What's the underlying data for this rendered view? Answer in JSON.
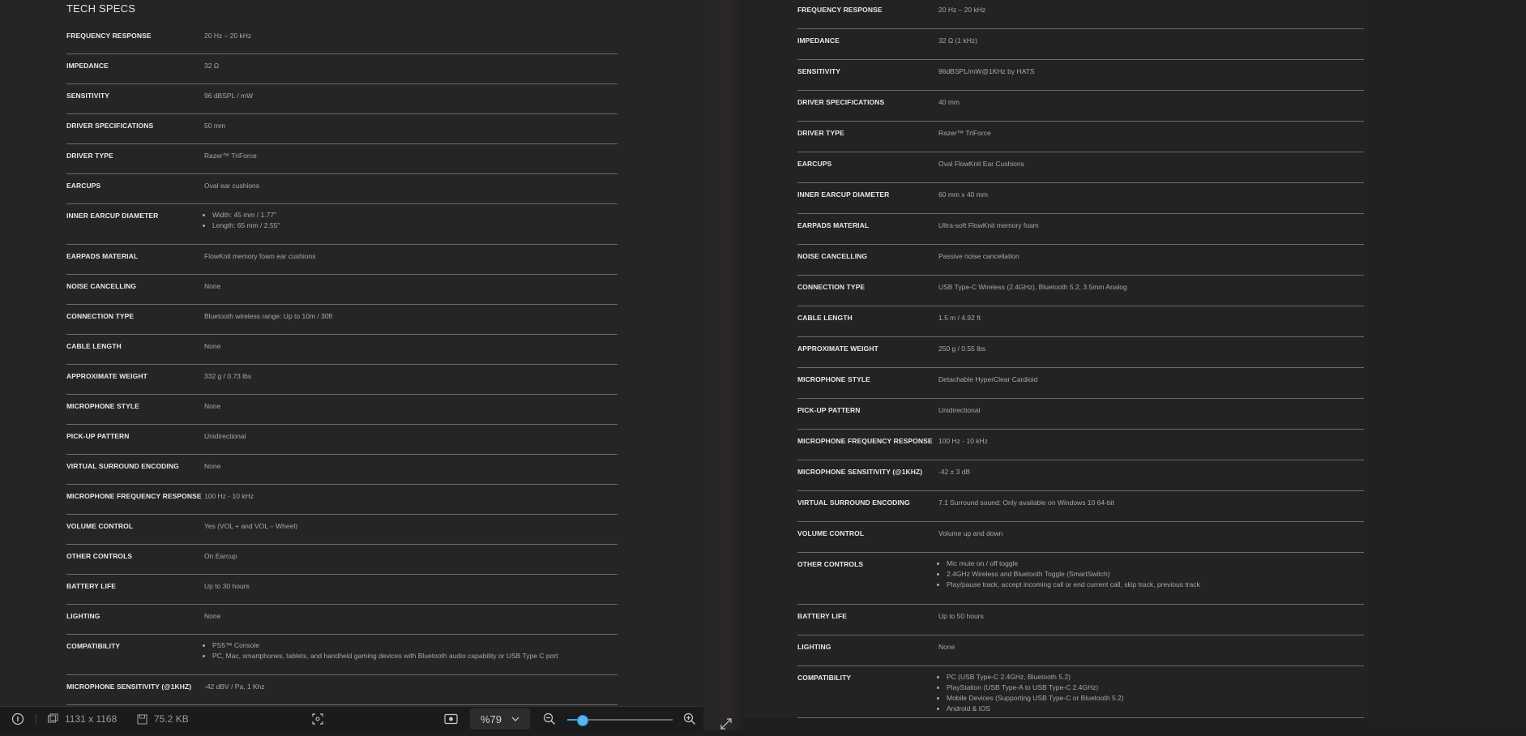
{
  "left": {
    "title": "TECH SPECS",
    "specs": [
      {
        "label": "FREQUENCY RESPONSE",
        "value": "20 Hz – 20 kHz"
      },
      {
        "label": "IMPEDANCE",
        "value": "32 Ω"
      },
      {
        "label": "SENSITIVITY",
        "value": "96 dBSPL / mW"
      },
      {
        "label": "DRIVER SPECIFICATIONS",
        "value": "50 mm"
      },
      {
        "label": "DRIVER TYPE",
        "value": "Razer™ TriForce"
      },
      {
        "label": "EARCUPS",
        "value": "Oval ear cushions"
      },
      {
        "label": "INNER EARCUP DIAMETER",
        "items": [
          "Width: 45 mm / 1.77\"",
          "Length: 65 mm / 2.55\""
        ]
      },
      {
        "label": "EARPADS MATERIAL",
        "value": "FlowKnit memory foam ear cushions"
      },
      {
        "label": "NOISE CANCELLING",
        "value": "None"
      },
      {
        "label": "CONNECTION TYPE",
        "value": "Bluetooth wireless range: Up to 10m / 30ft"
      },
      {
        "label": "CABLE LENGTH",
        "value": "None"
      },
      {
        "label": "APPROXIMATE WEIGHT",
        "value": "332 g / 0.73 lbs"
      },
      {
        "label": "MICROPHONE STYLE",
        "value": "None"
      },
      {
        "label": "PICK-UP PATTERN",
        "value": "Unidirectional"
      },
      {
        "label": "VIRTUAL SURROUND ENCODING",
        "value": "None"
      },
      {
        "label": "MICROPHONE FREQUENCY RESPONSE",
        "value": "100 Hz - 10 kHz"
      },
      {
        "label": "VOLUME CONTROL",
        "value": "Yes (VOL + and VOL – Wheel)"
      },
      {
        "label": "OTHER CONTROLS",
        "value": "On Earcup"
      },
      {
        "label": "BATTERY LIFE",
        "value": "Up to 30 hours"
      },
      {
        "label": "LIGHTING",
        "value": "None"
      },
      {
        "label": "COMPATIBILITY",
        "items": [
          "PS5™ Console",
          "PC, Mac, smartphones, tablets, and handheld gaming devices with Bluetooth audio capability or USB Type C port"
        ]
      },
      {
        "label": "MICROPHONE SENSITIVITY (@1KHZ)",
        "value": "-42 dBV / Pa, 1 Khz"
      }
    ]
  },
  "right": {
    "specs": [
      {
        "label": "FREQUENCY RESPONSE",
        "value": "20 Hz – 20 kHz"
      },
      {
        "label": "IMPEDANCE",
        "value": "32 Ω (1 kHz)"
      },
      {
        "label": "SENSITIVITY",
        "value": "96dBSPL/mW@1KHz by HATS"
      },
      {
        "label": "DRIVER SPECIFICATIONS",
        "value": "40 mm"
      },
      {
        "label": "DRIVER TYPE",
        "value": "Razer™ TriForce"
      },
      {
        "label": "EARCUPS",
        "value": "Oval FlowKnit Ear Cushions"
      },
      {
        "label": "INNER EARCUP DIAMETER",
        "value": "60 mm x 40 mm"
      },
      {
        "label": "EARPADS MATERIAL",
        "value": "Ultra-soft FlowKnit memory foam"
      },
      {
        "label": "NOISE CANCELLING",
        "value": "Passive noise cancellation"
      },
      {
        "label": "CONNECTION TYPE",
        "value": "USB Type-C Wireless (2.4GHz), Bluetooth 5.2, 3.5mm Analog"
      },
      {
        "label": "CABLE LENGTH",
        "value": "1.5 m / 4.92 ft"
      },
      {
        "label": "APPROXIMATE WEIGHT",
        "value": "250 g / 0.55 lbs"
      },
      {
        "label": "MICROPHONE STYLE",
        "value": "Detachable HyperClear Cardioid"
      },
      {
        "label": "PICK-UP PATTERN",
        "value": "Unidirectional"
      },
      {
        "label": "MICROPHONE FREQUENCY RESPONSE",
        "value": "100 Hz - 10 kHz"
      },
      {
        "label": "MICROPHONE SENSITIVITY (@1KHZ)",
        "value": "-42 ± 3 dB"
      },
      {
        "label": "VIRTUAL SURROUND ENCODING",
        "value": "7.1 Surround sound: Only available on Windows 10 64-bit"
      },
      {
        "label": "VOLUME CONTROL",
        "value": "Volume up and down"
      },
      {
        "label": "OTHER CONTROLS",
        "items": [
          "Mic mute on / off toggle",
          "2.4GHz Wireless and Bluetooth Toggle (SmartSwitch)",
          "Play/pause track, accept incoming call or end current call, skip track, previous track"
        ]
      },
      {
        "label": "BATTERY LIFE",
        "value": "Up to 50 hours"
      },
      {
        "label": "LIGHTING",
        "value": "None"
      },
      {
        "label": "COMPATIBILITY",
        "items": [
          "PC (USB Type-C 2.4GHz, Bluetooth 5.2)",
          "PlayStation (USB Type-A to USB Type-C 2.4GHz)",
          "Mobile Devices (Supporting USB Type-C or Bluetooth 5.2)",
          "Android & iOS"
        ]
      }
    ]
  },
  "status_bar": {
    "dimensions": "1131 x 1168",
    "file_size": "75.2 KB",
    "zoom": "%79",
    "zoom_fraction": 0.14,
    "icons": {
      "info": "info-icon",
      "dimensions": "image-size-icon",
      "size": "disk-icon",
      "crop": "focus-icon",
      "screen": "screen-icon",
      "zoom_out": "zoom-out-icon",
      "zoom_in": "zoom-in-icon",
      "expand": "expand-icon"
    }
  }
}
